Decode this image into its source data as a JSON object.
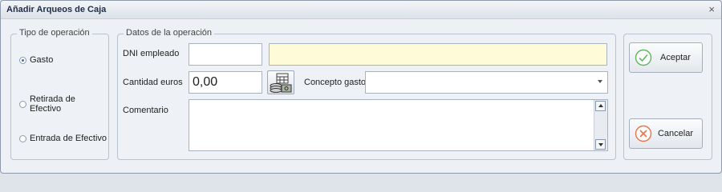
{
  "window": {
    "title": "Añadir Arqueos de Caja",
    "close_glyph": "×"
  },
  "tipo": {
    "legend": "Tipo de operación",
    "options": [
      {
        "label": "Gasto",
        "checked": true
      },
      {
        "label": "Retirada de Efectivo",
        "checked": false
      },
      {
        "label": "Entrada de Efectivo",
        "checked": false
      }
    ]
  },
  "datos": {
    "legend": "Datos de la operación",
    "dni_label": "DNI empleado",
    "dni_value": "",
    "nombre_value": "",
    "cantidad_label": "Cantidad euros",
    "cantidad_value": "0,00",
    "concepto_label": "Concepto gasto",
    "concepto_value": "",
    "comentario_label": "Comentario",
    "comentario_value": "",
    "calc_icon": "calculator-coins-icon"
  },
  "actions": {
    "accept_label": "Aceptar",
    "accept_icon": "check-circle-icon",
    "cancel_label": "Cancelar",
    "cancel_icon": "x-circle-icon"
  },
  "colors": {
    "accept": "#5cb85c",
    "cancel": "#e8734a",
    "highlight_field": "#fdfbd8"
  }
}
